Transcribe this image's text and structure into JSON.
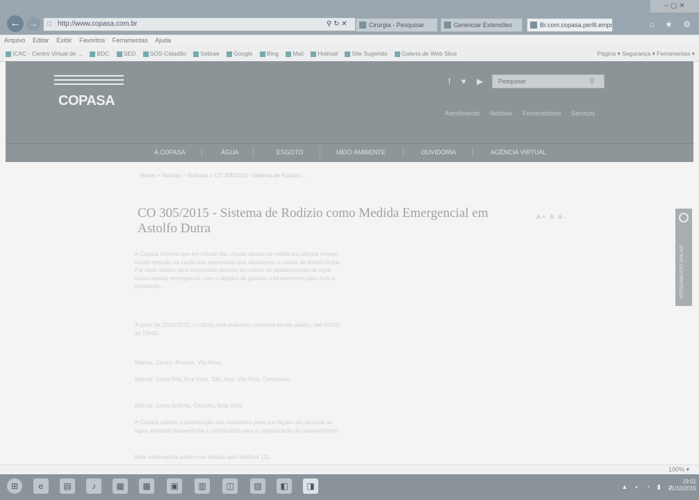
{
  "browser": {
    "address": "http://www.copasa.com.br",
    "tabs": [
      {
        "label": "Cirurgia - Pesquisar"
      },
      {
        "label": "Gerenciar Extensões"
      },
      {
        "label": "Br.com.copasa.perfil.empre..."
      }
    ],
    "window_controls": "– ▢ ✕",
    "top_icons": "⌂ ★ ⚙",
    "menu": [
      "Arquivo",
      "Editar",
      "Exibir",
      "Favoritos",
      "Ferramentas",
      "Ajuda"
    ],
    "favorites": [
      "ICAC - Centro Virtual de ...",
      "BDC",
      "SED",
      "SOS-Cidadão",
      "Sebrae",
      "Google",
      "Bing",
      "Mail",
      "Hotmail",
      "Site Sugerido",
      "Galeria de Web Slice"
    ],
    "tools_right": "Página ▾   Segurança ▾   Ferramentas ▾"
  },
  "site": {
    "logo_text": "COPASA",
    "social_icons": "f ♥ ▶ ◎",
    "search_placeholder": "Pesquisar",
    "user_links": [
      "Atendimento",
      "Notícias",
      "Fornecedores",
      "Serviços"
    ],
    "nav": [
      "A COPASA",
      "ÁGUA",
      "ESGOTO",
      "MEIO AMBIENTE",
      "OUVIDORIA",
      "AGÊNCIA VIRTUAL"
    ],
    "breadcrumb": "Home  >  Notícias  >  Notícias  >  CO 305/2015 - Sistema de Rodízio..."
  },
  "article": {
    "title": "CO 305/2015 - Sistema de Rodízio como Medida Emergencial em Astolfo Dutra",
    "font_controls": "A+ A A-",
    "paragraphs": [
      "A Copasa informa que em virtude das chuvas abaixo da média nos últimos meses, houve redução na vazão dos mananciais que abastecem a cidade de Astolfo Dutra. Por esse motivo, será implantado sistema de rodízio no abastecimento de água como medida emergencial, com o objetivo de garantir o fornecimento para toda a população.",
      "A partir de 22/10/2015, o rodízio será realizado conforme escala abaixo, das 07h00 às 19h00.",
      "Bairros: Centro, Rosário, Vila Nova.",
      "Bairros: Santa Rita, Boa Vista, São José, Vila Rica, Centenário.",
      "Bairros: Santo Antônio, Cruzeiro, Bela Vista.",
      "A Copasa solicita a colaboração dos moradores para que façam uso racional da água, evitando desperdícios e contribuindo para a regularização do abastecimento.",
      "Mais informações podem ser obtidas pelo telefone 115."
    ]
  },
  "side_tab": "ATENDIMENTO ONLINE",
  "status": {
    "zoom": "100%  ▾"
  },
  "taskbar": {
    "icons": [
      "⊞",
      "e",
      "▤",
      "♪",
      "▦",
      "▩",
      "▣",
      "▥",
      "◫",
      "▧",
      "◧",
      "◨"
    ],
    "tray": "▲ ◐ ◔ ▮ ♫",
    "time": "19:01",
    "date": "21/10/2015"
  }
}
